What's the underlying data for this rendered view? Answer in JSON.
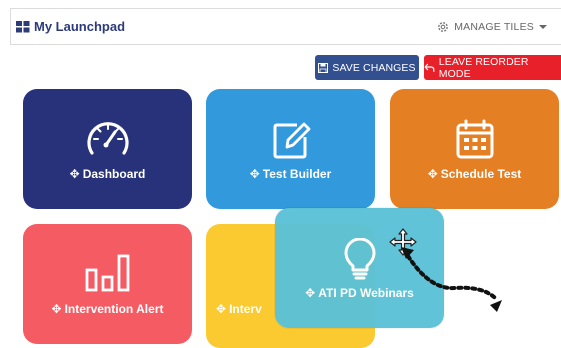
{
  "header": {
    "title": "My Launchpad",
    "manage_label": "MANAGE TILES"
  },
  "toolbar": {
    "save_label": "SAVE CHANGES",
    "leave_label": "LEAVE REORDER MODE"
  },
  "tiles": [
    {
      "label": "Dashboard",
      "icon": "speedometer-icon",
      "color": "#28327a"
    },
    {
      "label": "Test Builder",
      "icon": "edit-icon",
      "color": "#3199dc"
    },
    {
      "label": "Schedule Test",
      "icon": "calendar-icon",
      "color": "#e47f24"
    },
    {
      "label": "Intervention Alert",
      "icon": "bar-chart-icon",
      "color": "#f45b63"
    },
    {
      "label": "Interv",
      "icon": "",
      "color": "#fbc930"
    },
    {
      "label": "ATI PD Webinars",
      "icon": "lightbulb-icon",
      "color": "#5cc2d7"
    }
  ],
  "colors": {
    "save": "#324f8f",
    "leave": "#e8202a",
    "title": "#2c3b7a"
  }
}
